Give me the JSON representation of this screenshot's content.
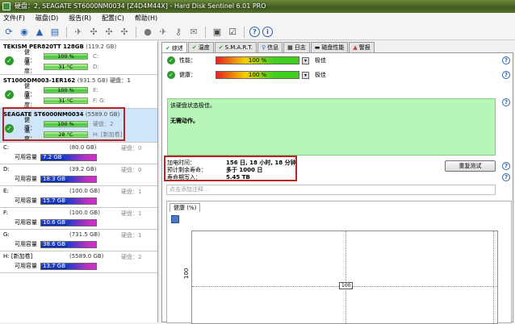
{
  "window": {
    "title": "硬盘：2, SEAGATE ST6000NM0034 [Z4D4M44X] - Hard Disk Sentinel 6.01 PRO"
  },
  "menu": [
    "磁盘(D)",
    "报告(R)",
    "配置(C)",
    "帮助(H)"
  ],
  "menu_prefix": "文件(F)",
  "disks": [
    {
      "name": "TEKISM PER820TT 128GB",
      "size": "(119.2 GB)",
      "health_label": "健康：",
      "health": "100 %",
      "health_ext": "C:",
      "temp_label": "温度：",
      "temp": "31 °C",
      "temp_ext": "D:"
    },
    {
      "name": "ST1000DM003-1ER162",
      "size": "(931.5 GB)",
      "extra": "硬盘：1",
      "health_label": "健康：",
      "health": "100 %",
      "health_ext": "E:",
      "temp_label": "温度：",
      "temp": "31 °C",
      "temp_ext": "F: G:"
    },
    {
      "name": "SEAGATE ST6000NM0034",
      "size": "(5589.0 GB)",
      "extra": "硬盘：2",
      "health_label": "健康：",
      "health": "100 %",
      "health_ext": "硬盘：2",
      "temp_label": "温度：",
      "temp": "28 °C",
      "temp_ext": "H: [新加卷]"
    }
  ],
  "volumes": [
    {
      "name": "C:",
      "size": "(80.0 GB)",
      "ext": "硬盘：0",
      "free_label": "可用容量",
      "free": "7.2 GB",
      "free_pct": 10
    },
    {
      "name": "D:",
      "size": "(39.2 GB)",
      "ext": "硬盘：0",
      "free_label": "可用容量",
      "free": "18.3 GB",
      "free_pct": 47
    },
    {
      "name": "E:",
      "size": "(100.0 GB)",
      "ext": "硬盘：1",
      "free_label": "可用容量",
      "free": "15.7 GB",
      "free_pct": 16
    },
    {
      "name": "F:",
      "size": "(100.0 GB)",
      "ext": "硬盘：1",
      "free_label": "可用容量",
      "free": "10.6 GB",
      "free_pct": 11
    },
    {
      "name": "G:",
      "size": "(731.5 GB)",
      "ext": "硬盘：1",
      "free_label": "可用容量",
      "free": "38.6 GB",
      "free_pct": 5
    },
    {
      "name": "H: [新加卷]",
      "size": "(5589.0 GB)",
      "ext": "硬盘：2",
      "free_label": "可用容量",
      "free": "13.7 GB",
      "free_pct": 1
    }
  ],
  "tabs": [
    "综述",
    "温度",
    "S.M.A.R.T.",
    "信息",
    "日志",
    "磁盘性能",
    "警报"
  ],
  "metrics": {
    "perf_label": "性能：",
    "perf_value": "100 %",
    "perf_text": "极佳",
    "health_label": "健康：",
    "health_value": "100 %",
    "health_text": "极佳"
  },
  "status": {
    "line1": "该硬盘状态极佳。",
    "line2": "无需动作。"
  },
  "info": {
    "power_on_label": "加电时间：",
    "power_on_value": "156 日, 18 小时, 18 分钟",
    "remaining_label": "预计剩余寿命：",
    "remaining_value": "多于 1000 日",
    "written_label": "寿命期写入：",
    "written_value": "5.45 TB"
  },
  "reset_button": "重复测试",
  "comment_placeholder": "点击添加注释...",
  "chart_tab": "健康 (%)",
  "chart_data": {
    "type": "line",
    "x": [],
    "series": [
      {
        "values": [
          100
        ]
      }
    ],
    "ylabel": "100",
    "point_label": "100"
  }
}
